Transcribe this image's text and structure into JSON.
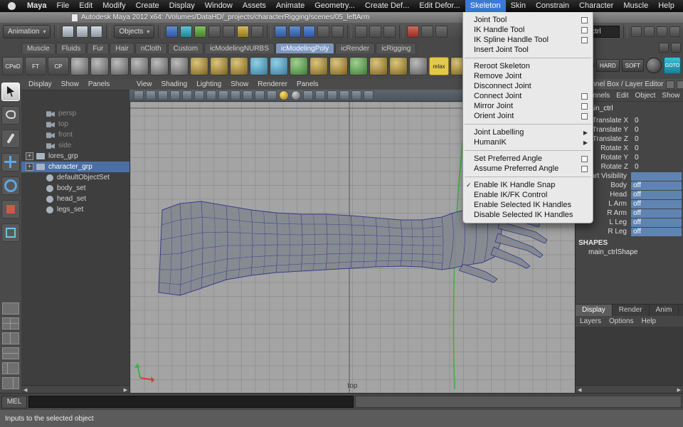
{
  "colors": {
    "accent-blue": "#3b7ad9",
    "selection-blue": "#4a6fa5",
    "channel-field-blue": "#5f84b2",
    "viewport-bg": "#a4a4a4",
    "wireframe-blue": "#2b2f8a",
    "curve-green": "#3fae4a",
    "active-tab-blue": "#7d97bd",
    "relax-yellow": "#e3c84b"
  },
  "glyphs": {
    "check": "✓",
    "submenu": "▶",
    "dropdown": "▾",
    "left": "◀",
    "right": "▶"
  },
  "menubar": {
    "items": [
      {
        "label": "Maya",
        "bold": true
      },
      {
        "label": "File"
      },
      {
        "label": "Edit"
      },
      {
        "label": "Modify"
      },
      {
        "label": "Create"
      },
      {
        "label": "Display"
      },
      {
        "label": "Window"
      },
      {
        "label": "Assets"
      },
      {
        "label": "Animate"
      },
      {
        "label": "Geometry..."
      },
      {
        "label": "Create Def..."
      },
      {
        "label": "Edit Defor..."
      },
      {
        "label": "Skeleton",
        "active": true
      },
      {
        "label": "Skin"
      },
      {
        "label": "Constrain"
      },
      {
        "label": "Character"
      },
      {
        "label": "Muscle"
      },
      {
        "label": "Help"
      }
    ]
  },
  "titlebar": {
    "title": "Autodesk Maya 2012 x64: /Volumes/DataHD/_projects/characterRigging/scenes/05_leftArm"
  },
  "statusline": {
    "menuset": "Animation",
    "mask": "Objects",
    "rename": "main_ctrl"
  },
  "shelf": {
    "tabs": [
      {
        "label": "Muscle"
      },
      {
        "label": "Fluids"
      },
      {
        "label": "Fur"
      },
      {
        "label": "Hair"
      },
      {
        "label": "nCloth"
      },
      {
        "label": "Custom"
      },
      {
        "label": "icModelingNURBS"
      },
      {
        "label": "icModelingPoly",
        "active": true
      },
      {
        "label": "icRender"
      },
      {
        "label": "icRigging"
      }
    ],
    "text_buttons": [
      {
        "label": "CPeD"
      },
      {
        "label": "FT"
      },
      {
        "label": "CP"
      }
    ],
    "relax": "relax",
    "hard": "HARD",
    "soft": "SOFT",
    "goto": "GOTO"
  },
  "outliner": {
    "menus": [
      {
        "label": "Display"
      },
      {
        "label": "Show"
      },
      {
        "label": "Panels"
      }
    ],
    "items": [
      {
        "label": "persp",
        "dim": true,
        "cam": true
      },
      {
        "label": "top",
        "dim": true,
        "cam": true
      },
      {
        "label": "front",
        "dim": true,
        "cam": true
      },
      {
        "label": "side",
        "dim": true,
        "cam": true
      },
      {
        "label": "lores_grp",
        "expand": true
      },
      {
        "label": "character_grp",
        "expand": true,
        "selected": true
      },
      {
        "label": "defaultObjectSet",
        "set": true
      },
      {
        "label": "body_set",
        "set": true
      },
      {
        "label": "head_set",
        "set": true
      },
      {
        "label": "legs_set",
        "set": true
      }
    ]
  },
  "viewport": {
    "menus": [
      {
        "label": "View"
      },
      {
        "label": "Shading"
      },
      {
        "label": "Lighting"
      },
      {
        "label": "Show"
      },
      {
        "label": "Renderer"
      },
      {
        "label": "Panels"
      }
    ],
    "view_label": "top"
  },
  "skeleton_menu": {
    "items": [
      {
        "label": "Joint Tool",
        "optionbox": true
      },
      {
        "label": "IK Handle Tool",
        "optionbox": true
      },
      {
        "label": "IK Spline Handle Tool",
        "optionbox": true
      },
      {
        "label": "Insert Joint Tool"
      },
      {
        "separator": true,
        "label": ""
      },
      {
        "label": "Reroot Skeleton"
      },
      {
        "label": "Remove Joint"
      },
      {
        "label": "Disconnect Joint"
      },
      {
        "label": "Connect Joint",
        "optionbox": true
      },
      {
        "label": "Mirror Joint",
        "optionbox": true
      },
      {
        "label": "Orient Joint",
        "optionbox": true
      },
      {
        "separator": true,
        "label": ""
      },
      {
        "label": "Joint Labelling",
        "submenu": true
      },
      {
        "label": "HumanIK",
        "submenu": true
      },
      {
        "separator": true,
        "label": ""
      },
      {
        "label": "Set Preferred Angle",
        "optionbox": true
      },
      {
        "label": "Assume Preferred Angle",
        "optionbox": true
      },
      {
        "separator": true,
        "label": ""
      },
      {
        "label": "Enable IK Handle Snap",
        "checked": true
      },
      {
        "label": "Enable IK/FK Control"
      },
      {
        "label": "Enable Selected IK Handles"
      },
      {
        "label": "Disable Selected IK Handles"
      }
    ]
  },
  "channel_box": {
    "header": "Channel Box / Layer Editor",
    "menus": [
      {
        "label": "Channels"
      },
      {
        "label": "Edit"
      },
      {
        "label": "Object"
      },
      {
        "label": "Show"
      }
    ],
    "object_name": "main_ctrl",
    "rows": [
      {
        "name": "Translate X",
        "value": "0"
      },
      {
        "name": "Translate Y",
        "value": "0"
      },
      {
        "name": " Translate Z",
        "value": "0"
      },
      {
        "name": "Rotate X",
        "value": "0"
      },
      {
        "name": "Rotate Y",
        "value": "0"
      },
      {
        "name": "Rotate Z",
        "value": "0"
      },
      {
        "name": "Part Visibility",
        "value": "",
        "blue": true
      },
      {
        "name": "Body",
        "value": "off",
        "blue": true
      },
      {
        "name": "Head",
        "value": "off",
        "blue": true
      },
      {
        "name": "L Arm",
        "value": "off",
        "blue": true
      },
      {
        "name": "R Arm",
        "value": "off",
        "blue": true
      },
      {
        "name": "L Leg",
        "value": "off",
        "blue": true
      },
      {
        "name": "R Leg",
        "value": "off",
        "blue": true
      }
    ],
    "shapes_label": "SHAPES",
    "shape_name": "main_ctrlShape",
    "editor_tabs": [
      {
        "label": "Display",
        "active": true
      },
      {
        "label": "Render"
      },
      {
        "label": "Anim"
      }
    ],
    "layer_menus": [
      {
        "label": "Layers"
      },
      {
        "label": "Options"
      },
      {
        "label": "Help"
      }
    ]
  },
  "command_line": {
    "label": "MEL"
  },
  "help_line": {
    "text": "Inputs to the selected object"
  }
}
